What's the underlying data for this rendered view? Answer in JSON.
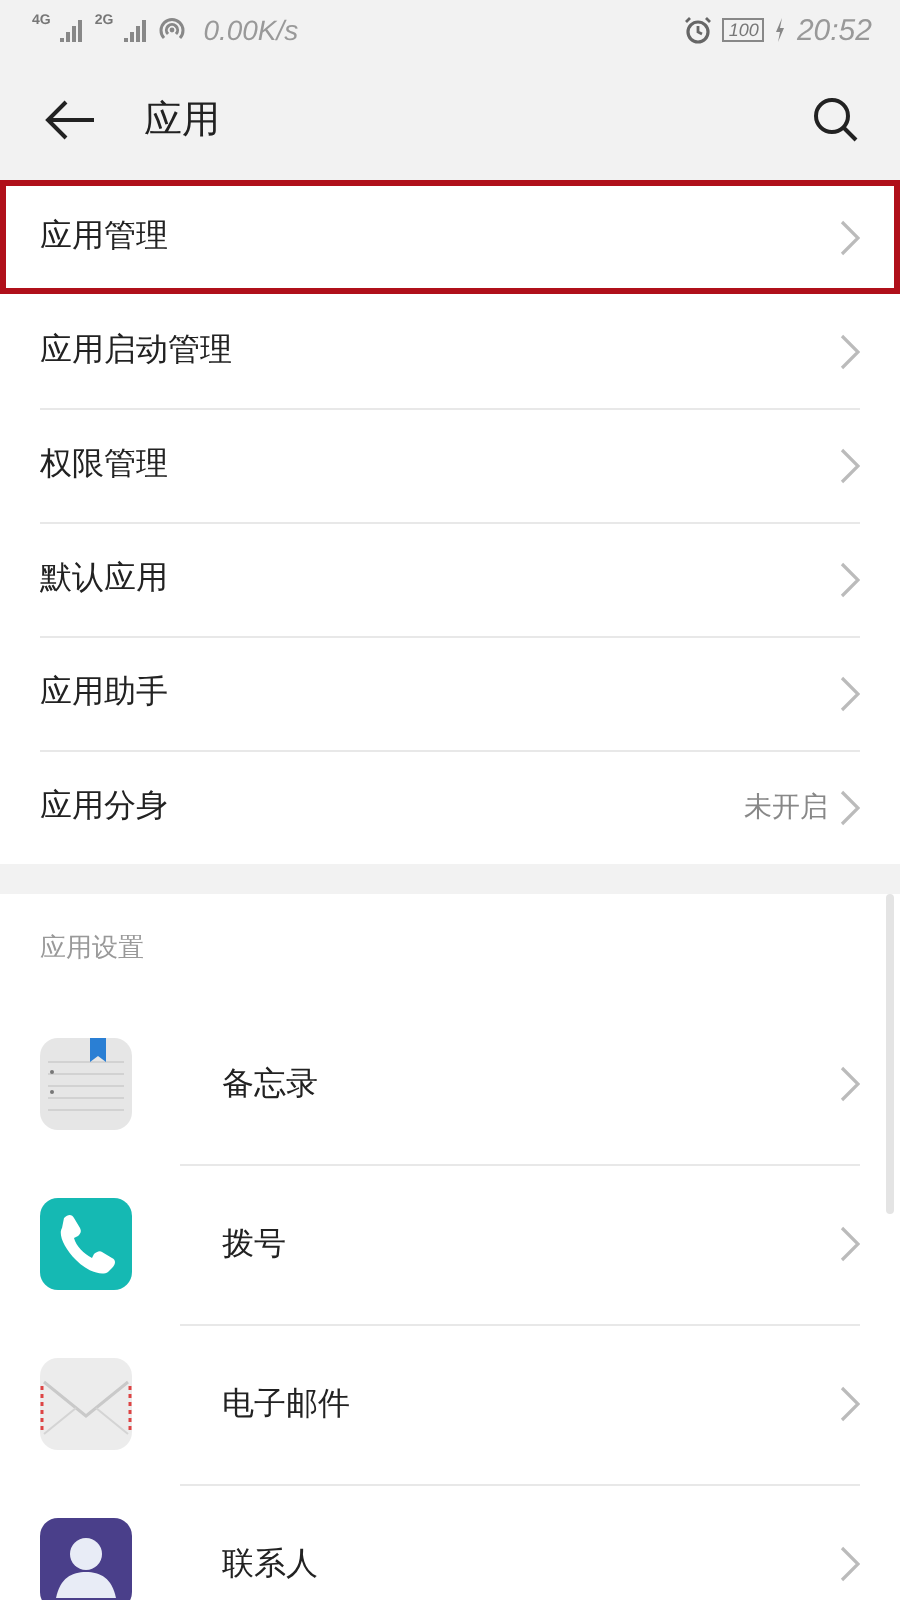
{
  "status_bar": {
    "sim1": "4G",
    "sim2": "2G",
    "speed": "0.00K/s",
    "battery": "100",
    "time": "20:52"
  },
  "toolbar": {
    "title": "应用"
  },
  "menu": [
    {
      "label": "应用管理",
      "selected": true
    },
    {
      "label": "应用启动管理",
      "selected": false
    },
    {
      "label": "权限管理",
      "selected": false
    },
    {
      "label": "默认应用",
      "selected": false
    },
    {
      "label": "应用助手",
      "selected": false
    },
    {
      "label": "应用分身",
      "selected": false,
      "value": "未开启"
    }
  ],
  "app_settings": {
    "header": "应用设置",
    "apps": [
      {
        "name": "备忘录",
        "kind": "notes"
      },
      {
        "name": "拨号",
        "kind": "phone"
      },
      {
        "name": "电子邮件",
        "kind": "mail"
      },
      {
        "name": "联系人",
        "kind": "contacts"
      }
    ]
  }
}
